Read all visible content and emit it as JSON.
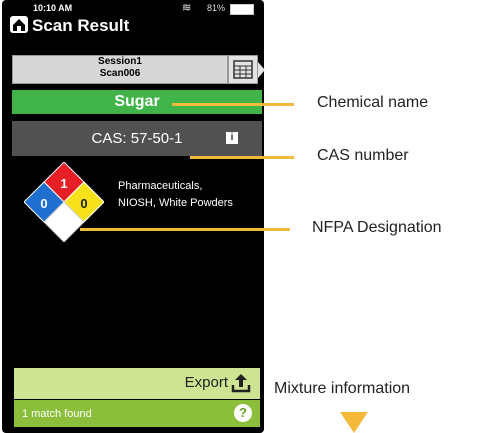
{
  "status": {
    "time": "10:10 AM",
    "battery": "81%"
  },
  "header": {
    "title": "Scan Result"
  },
  "session": {
    "line1": "Session1",
    "line2": "Scan006"
  },
  "result": {
    "chemical_name": "Sugar",
    "cas": "CAS: 57-50-1",
    "nfpa": {
      "health": "0",
      "flammability": "1",
      "reactivity": "0",
      "special": ""
    },
    "designation_line1": "Pharmaceuticals,",
    "designation_line2": "NIOSH, White Powders"
  },
  "actions": {
    "export_label": "Export"
  },
  "footer": {
    "match_text": "1 match found",
    "help": "?"
  },
  "callouts": {
    "chemical_name": "Chemical name",
    "cas_number": "CAS number",
    "nfpa": "NFPA Designation",
    "mixture": "Mixture information"
  },
  "colors": {
    "green": "#41b449",
    "gray": "#515151",
    "export_bg": "#cfe492",
    "footer_bg": "#8bbf3b",
    "callout_line": "#f3b93b"
  },
  "icons": [
    "home-icon",
    "wifi-icon",
    "battery-icon",
    "grid-icon",
    "info-icon",
    "export-icon",
    "help-icon"
  ]
}
